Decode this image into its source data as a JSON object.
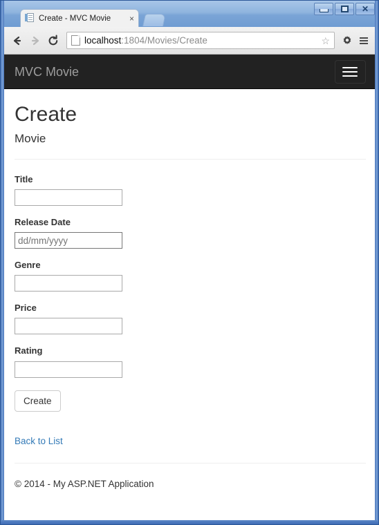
{
  "window": {
    "controls": {
      "minimize_label": "Minimize",
      "maximize_label": "Maximize",
      "close_label": "Close"
    }
  },
  "browser": {
    "tab": {
      "title": "Create - MVC Movie",
      "close_label": "×"
    },
    "new_tab_label": "New Tab",
    "nav": {
      "back_label": "Back",
      "forward_label": "Forward",
      "reload_label": "Reload"
    },
    "omnibox": {
      "host": "localhost",
      "path": ":1804/Movies/Create",
      "full_url": "localhost:1804/Movies/Create",
      "bookmark_label": "☆"
    },
    "toolbar": {
      "settings_label": "Settings",
      "menu_label": "Customize and control"
    }
  },
  "page": {
    "navbar": {
      "brand": "MVC Movie",
      "toggle_label": "Toggle navigation"
    },
    "heading": "Create",
    "subheading": "Movie",
    "form": {
      "fields": [
        {
          "label": "Title",
          "value": "",
          "placeholder": "",
          "type": "text"
        },
        {
          "label": "Release Date",
          "value": "",
          "placeholder": "dd/mm/yyyy",
          "type": "date"
        },
        {
          "label": "Genre",
          "value": "",
          "placeholder": "",
          "type": "text"
        },
        {
          "label": "Price",
          "value": "",
          "placeholder": "",
          "type": "text"
        },
        {
          "label": "Rating",
          "value": "",
          "placeholder": "",
          "type": "text"
        }
      ],
      "submit_label": "Create"
    },
    "back_link": "Back to List",
    "footer": "© 2014 - My ASP.NET Application"
  },
  "colors": {
    "navbar_bg": "#222222",
    "brand_text": "#9d9d9d",
    "link": "#337ab7",
    "body_text": "#333333",
    "rule": "#eeeeee",
    "frame_blue": "#2b5797"
  }
}
